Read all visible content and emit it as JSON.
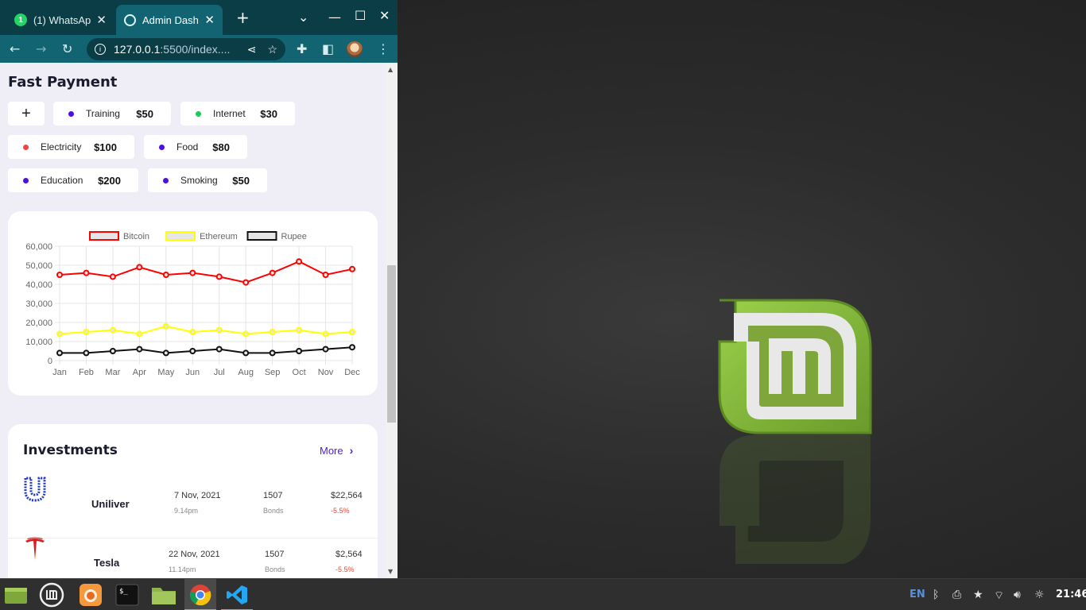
{
  "browser": {
    "tabs": [
      {
        "title": "(1) WhatsAp",
        "badge": "1",
        "icon": "whatsapp-icon"
      },
      {
        "title": "Admin Dash",
        "icon": "globe-icon"
      }
    ],
    "close_glyph": "✕",
    "new_tab_glyph": "+",
    "url_host": "127.0.0.1",
    "url_path": ":5500/index...."
  },
  "fast_payment": {
    "title": "Fast Payment",
    "add_label": "+",
    "items": [
      {
        "label": "Training",
        "amount": "$50",
        "color": "#4b0fe0"
      },
      {
        "label": "Internet",
        "amount": "$30",
        "color": "#22c55e"
      },
      {
        "label": "Electricity",
        "amount": "$100",
        "color": "#ef4444"
      },
      {
        "label": "Food",
        "amount": "$80",
        "color": "#4b0fe0"
      },
      {
        "label": "Education",
        "amount": "$200",
        "color": "#4b0fe0"
      },
      {
        "label": "Smoking",
        "amount": "$50",
        "color": "#4b0fe0"
      }
    ]
  },
  "chart_data": {
    "type": "line",
    "categories": [
      "Jan",
      "Feb",
      "Mar",
      "Apr",
      "May",
      "Jun",
      "Jul",
      "Aug",
      "Sep",
      "Oct",
      "Nov",
      "Dec"
    ],
    "series": [
      {
        "name": "Bitcoin",
        "color": "#ff0000",
        "values": [
          45000,
          46000,
          44000,
          49000,
          45000,
          46000,
          44000,
          41000,
          46000,
          52000,
          45000,
          48000
        ]
      },
      {
        "name": "Ethereum",
        "color": "#ffff00",
        "values": [
          14000,
          15000,
          16000,
          14000,
          18000,
          15000,
          16000,
          14000,
          15000,
          16000,
          14000,
          15000
        ]
      },
      {
        "name": "Rupee",
        "color": "#111111",
        "values": [
          4000,
          4000,
          5000,
          6000,
          4000,
          5000,
          6000,
          4000,
          4000,
          5000,
          6000,
          7000
        ]
      }
    ],
    "yticks": [
      "0",
      "10,000",
      "20,000",
      "30,000",
      "40,000",
      "50,000",
      "60,000"
    ],
    "ylim": [
      0,
      60000
    ],
    "grid": true,
    "legend": "top"
  },
  "investments": {
    "title": "Investments",
    "more_label": "More",
    "rows": [
      {
        "name": "Uniliver",
        "date": "7 Nov, 2021",
        "time": "9.14pm",
        "qty": "1507",
        "type": "Bonds",
        "price": "$22,564",
        "change": "-5.5%",
        "logo": "unilever-logo"
      },
      {
        "name": "Tesla",
        "date": "22 Nov, 2021",
        "time": "11.14pm",
        "qty": "1507",
        "type": "Bonds",
        "price": "$2,564",
        "change": "-5.5%",
        "logo": "tesla-logo"
      }
    ]
  },
  "taskbar": {
    "lang": "EN",
    "clock": "21:46"
  }
}
